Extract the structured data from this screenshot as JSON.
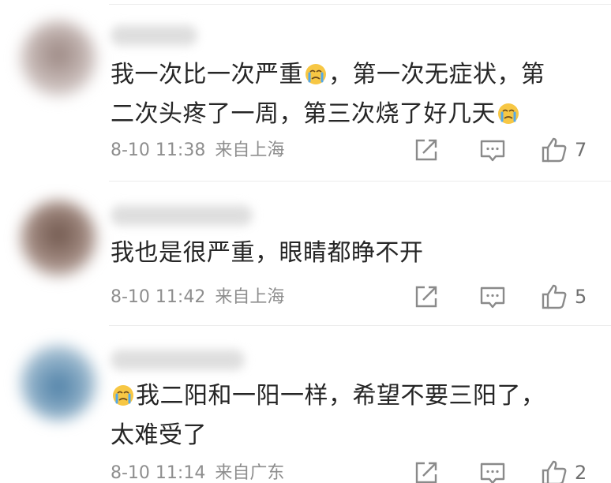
{
  "comments": [
    {
      "text_line1_a": "我一次比一次严重",
      "text_line1_b": "，第一次无症状，第",
      "text_line2": "二次头疼了一周，第三次烧了好几天",
      "date_time": "8-10 11:38",
      "location": "来自上海",
      "likes": "7",
      "avatar_color": "#b8a9a6",
      "emoji": "crying-face-emoji"
    },
    {
      "text_line1": "我也是很严重，眼睛都睁不开",
      "date_time": "8-10 11:42",
      "location": "来自上海",
      "likes": "5",
      "avatar_color": "#8a7166"
    },
    {
      "text_line1": "我二阳和一阳一样，希望不要三阳了，",
      "text_line2": "太难受了",
      "date_time": "8-10 11:14",
      "location": "来自广东",
      "likes": "2",
      "avatar_color": "#6f8fa8",
      "emoji": "crying-face-emoji"
    }
  ],
  "colors": {
    "text": "#262626",
    "meta": "#8e8e8e",
    "divider": "#ececec",
    "emoji_face": "#f7c744",
    "emoji_tears": "#54a8e8"
  },
  "icons": [
    "share-icon",
    "reply-icon",
    "like-icon"
  ]
}
